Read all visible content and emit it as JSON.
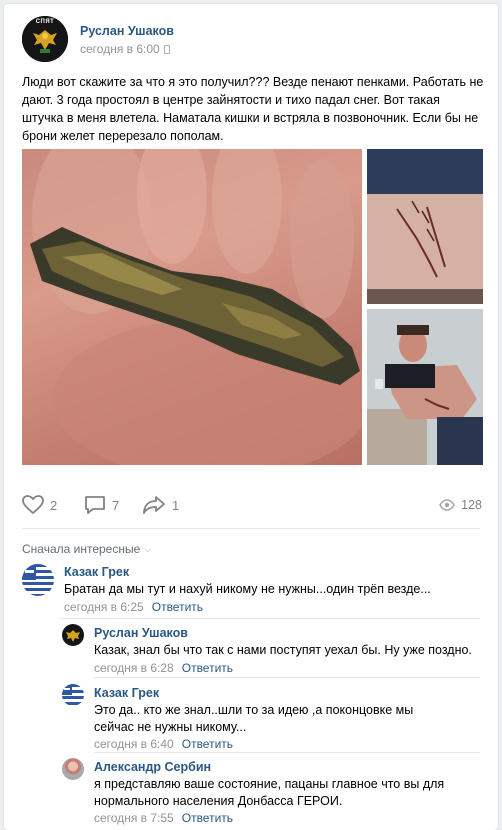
{
  "post": {
    "author": "Руслан Ушаков",
    "time": "сегодня в 6:00",
    "text": "Люди вот скажите за что я это получил??? Везде пенают пенками. Работать не дают. 3 года простоял в центре зайнятости и тихо падал снег. Вот такая штучка в меня влетела. Наматала кишки и встряла в позвоночник. Если бы не брони желет перерезало пополам.",
    "avatar_label": "СПЯТ",
    "likes": "2",
    "comments": "7",
    "shares": "1",
    "views": "128"
  },
  "comments_section": {
    "sort_label": "Сначала интересные"
  },
  "comments": [
    {
      "author": "Казак Грек",
      "text": "Братан да мы тут и нахуй никому не нужны...один трёп везде...",
      "time": "сегодня в 6:25",
      "reply": "Ответить"
    },
    {
      "author": "Руслан Ушаков",
      "text": "Казак, знал бы что так с нами поступят уехал бы. Ну уже поздно.",
      "time": "сегодня в 6:28",
      "reply": "Ответить"
    },
    {
      "author": "Казак Грек",
      "text": "Это да.. кто же знал..шли то за идею ,а поконцовке мы сейчас не нужны никому...",
      "time": "сегодня в 6:40",
      "reply": "Ответить"
    },
    {
      "author": "Александр Сербин",
      "text": "я представляю ваше состояние, пацаны главное что вы для нормального населения Донбасса ГЕРОИ.",
      "time": "сегодня в 7:55",
      "reply": "Ответить"
    }
  ],
  "colors": {
    "link": "#2a5885",
    "muted": "#939393",
    "icon": "#828282"
  }
}
